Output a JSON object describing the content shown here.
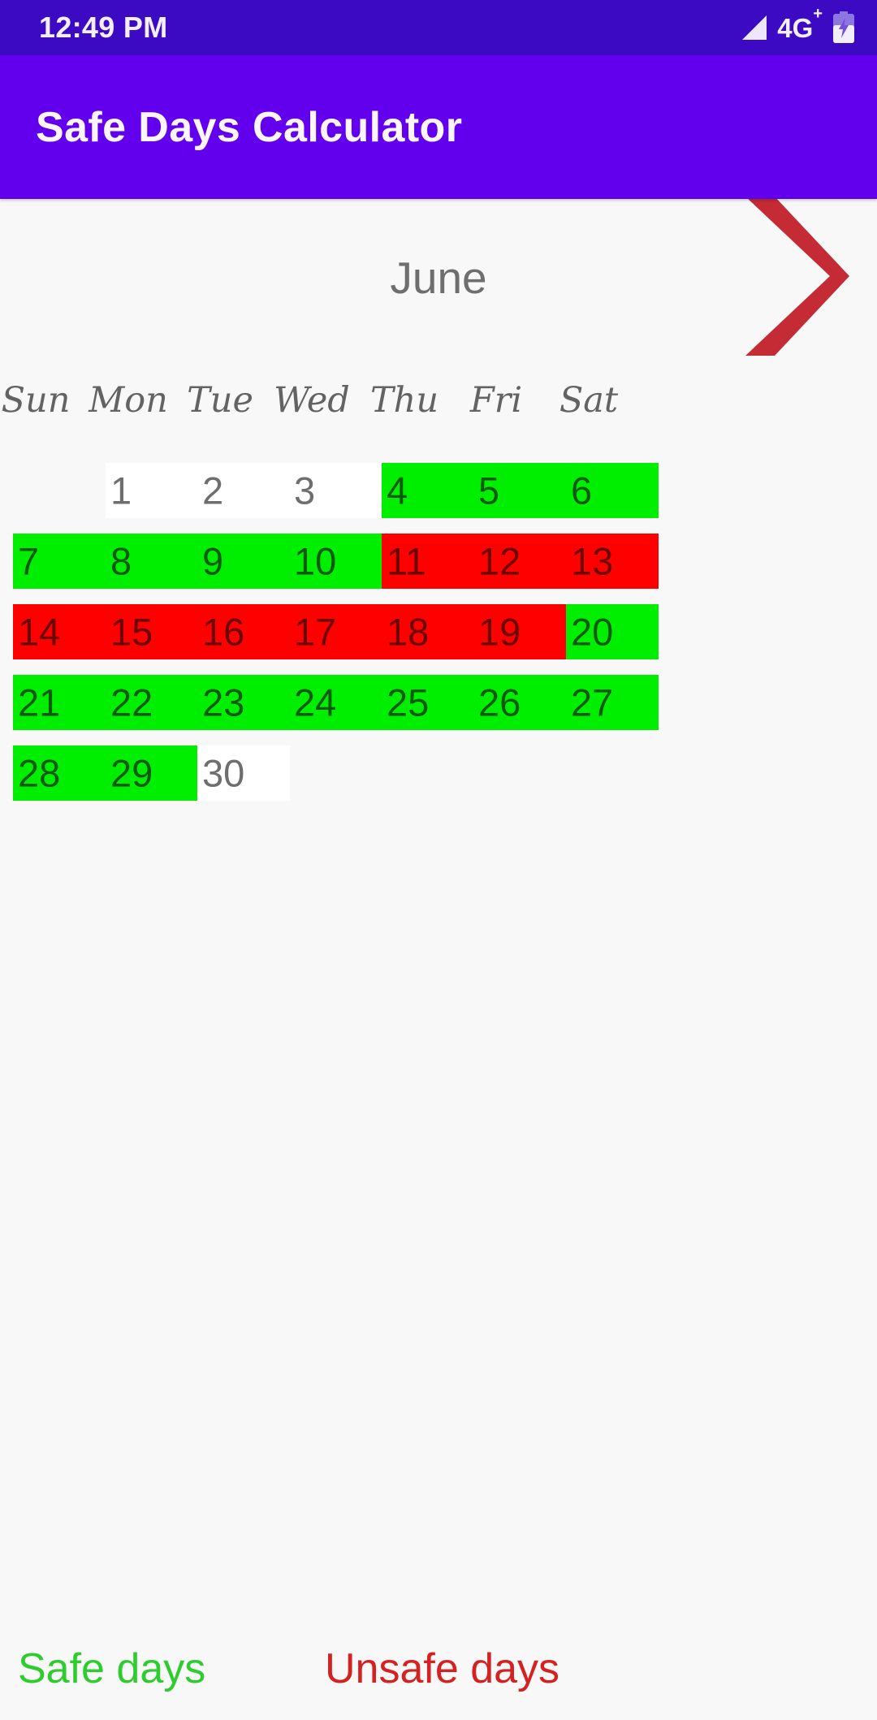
{
  "status_bar": {
    "time": "12:49 PM",
    "network_label": "4G",
    "network_plus": "+",
    "signal_icon": "signal-triangle-icon",
    "battery_icon": "battery-charging-icon"
  },
  "app_bar": {
    "title": "Safe Days Calculator",
    "background": "#6200EE"
  },
  "month_header": {
    "month": "June",
    "next_icon": "chevron-right-icon",
    "next_icon_color": "#C42B34"
  },
  "weekdays": [
    "Sun",
    "Mon",
    "Tue",
    "Wed",
    "Thu",
    "Fri",
    "Sat"
  ],
  "calendar": {
    "start_weekday_index": 1,
    "days": [
      {
        "day": "1",
        "state": "none"
      },
      {
        "day": "2",
        "state": "none"
      },
      {
        "day": "3",
        "state": "none"
      },
      {
        "day": "4",
        "state": "safe"
      },
      {
        "day": "5",
        "state": "safe"
      },
      {
        "day": "6",
        "state": "safe"
      },
      {
        "day": "7",
        "state": "safe"
      },
      {
        "day": "8",
        "state": "safe"
      },
      {
        "day": "9",
        "state": "safe"
      },
      {
        "day": "10",
        "state": "safe"
      },
      {
        "day": "11",
        "state": "unsafe"
      },
      {
        "day": "12",
        "state": "unsafe"
      },
      {
        "day": "13",
        "state": "unsafe"
      },
      {
        "day": "14",
        "state": "unsafe"
      },
      {
        "day": "15",
        "state": "unsafe"
      },
      {
        "day": "16",
        "state": "unsafe"
      },
      {
        "day": "17",
        "state": "unsafe"
      },
      {
        "day": "18",
        "state": "unsafe"
      },
      {
        "day": "19",
        "state": "unsafe"
      },
      {
        "day": "20",
        "state": "safe"
      },
      {
        "day": "21",
        "state": "safe"
      },
      {
        "day": "22",
        "state": "safe"
      },
      {
        "day": "23",
        "state": "safe"
      },
      {
        "day": "24",
        "state": "safe"
      },
      {
        "day": "25",
        "state": "safe"
      },
      {
        "day": "26",
        "state": "safe"
      },
      {
        "day": "27",
        "state": "safe"
      },
      {
        "day": "28",
        "state": "safe"
      },
      {
        "day": "29",
        "state": "safe"
      },
      {
        "day": "30",
        "state": "none"
      }
    ],
    "colors": {
      "safe": "#00EE00",
      "unsafe": "#FF0000",
      "none": "#FFFFFF"
    }
  },
  "legend": {
    "safe_label": "Safe days",
    "safe_color": "#2ECC2E",
    "unsafe_label": "Unsafe days",
    "unsafe_color": "#D42222"
  }
}
